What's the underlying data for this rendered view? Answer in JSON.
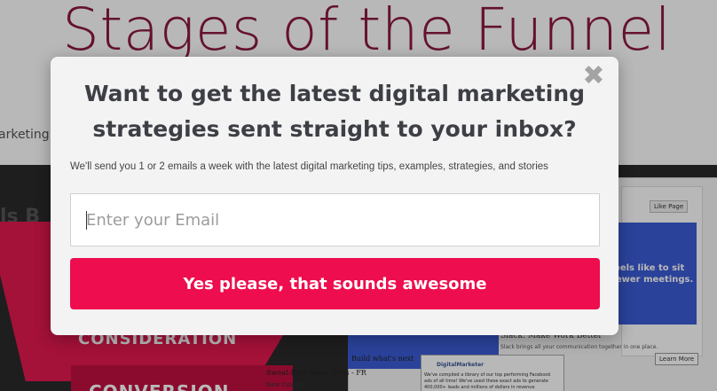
{
  "page": {
    "title": "Stages of the Funnel",
    "breadcrumb": "arketing -"
  },
  "hero": {
    "left_text": "ls B",
    "funnel_labels": [
      "CONSIDERATION",
      "CONVERSION"
    ],
    "ads": {
      "like_page": "Like Page",
      "blue_text": "it feels like to sit\n% fewer meetings.",
      "slack_caption": "Slack: Make Work Better",
      "slack_sub": "Slack brings all your communication together in one place.",
      "learn_more": "Learn More",
      "build_heading": "Build what's next",
      "dm_name": "DigitalMarketer",
      "dm_text": "We've compiled a library of our top performing Facebook ads of all time! We've used these exact ads to generate 400,000+ leads and millions of dollars in revenue",
      "sweat_heading": "Sweat-Free Sales Calls - FR",
      "sweat_sub": "New Coaches"
    }
  },
  "modal": {
    "heading": "Want to get the latest digital marketing strategies sent straight to your inbox?",
    "subtext": "We'll send you 1 or 2 emails a week with the latest digital marketing tips, examples, strategies, and stories",
    "email_placeholder": "Enter your Email",
    "email_value": "",
    "submit_label": "Yes please, that sounds awesome",
    "close_symbol": "✖"
  },
  "colors": {
    "title": "#8c1a3f",
    "accent": "#ee0d4e",
    "heading": "#3d3f45",
    "modal_bg": "#f3f3f3"
  }
}
